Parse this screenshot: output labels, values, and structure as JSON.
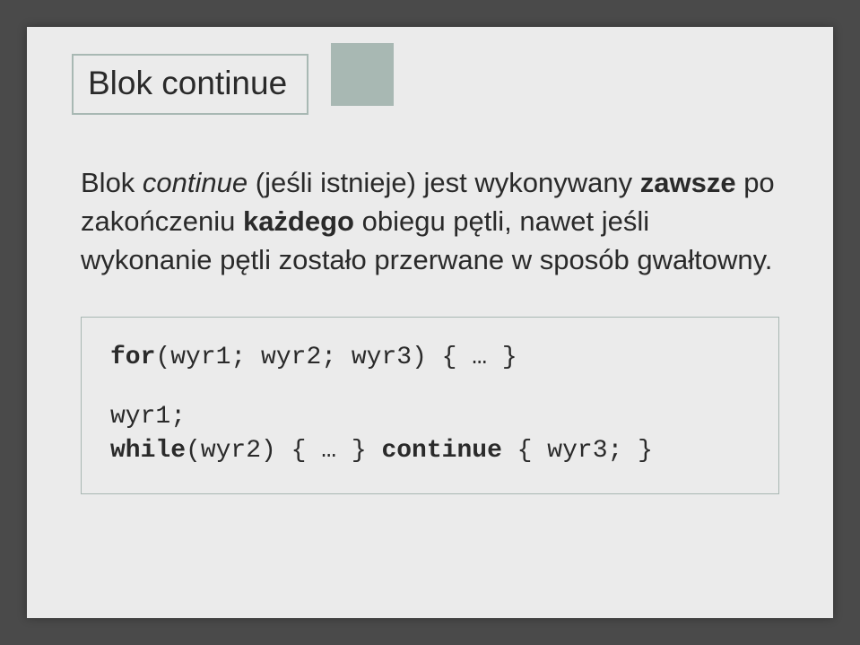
{
  "slide": {
    "title": "Blok continue",
    "paragraph": {
      "p1": "Blok ",
      "p2": "continue",
      "p3": " (jeśli istnieje) jest wykonywany ",
      "p4": "zawsze",
      "p5": " po zakończeniu ",
      "p6": "każdego",
      "p7": " obiegu pętli, nawet jeśli wykonanie pętli zostało przerwane w sposób gwałtowny."
    },
    "code": {
      "kw_for": "for",
      "line1_rest": "(wyr1; wyr2; wyr3) { … }",
      "line2": "wyr1;",
      "kw_while": "while",
      "line3_mid": "(wyr2) { … } ",
      "kw_continue": "continue",
      "line3_end": " { wyr3; }"
    }
  }
}
